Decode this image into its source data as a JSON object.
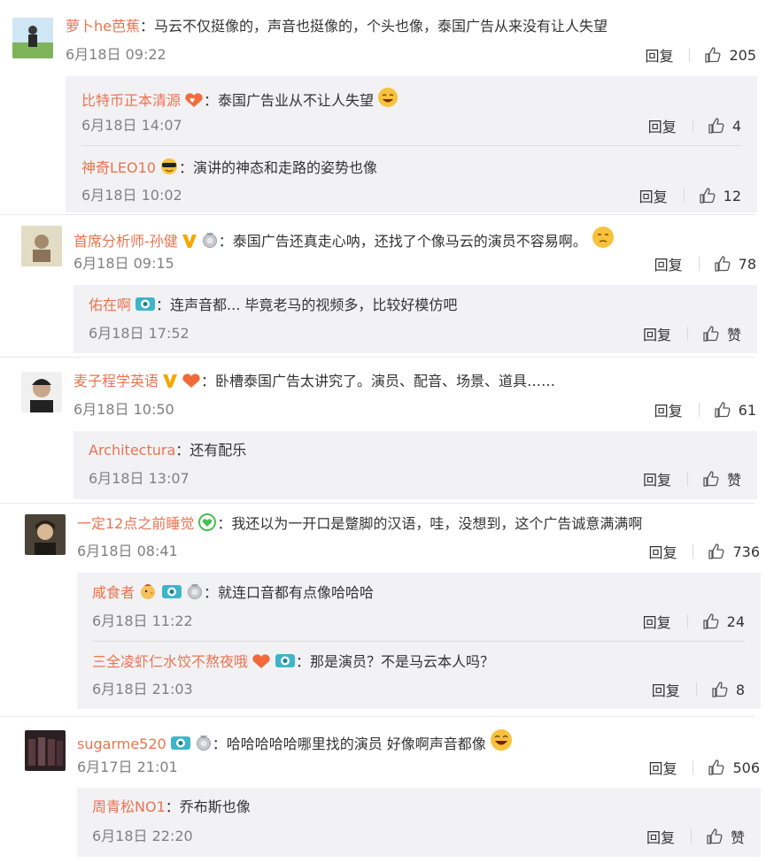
{
  "ui": {
    "reply_label": "回复",
    "colon": "："
  },
  "threads": [
    {
      "user": "萝卜he芭蕉",
      "text": "马云不仅挺像的，声音也挺像的，个头也像，泰国广告从来没有让人失望",
      "time": "6月18日 09:22",
      "likes": "205",
      "replies": [
        {
          "user": "比特币正本清源",
          "text": "泰国广告业从不让人失望",
          "time": "6月18日 14:07",
          "likes": "4"
        },
        {
          "user": "神奇LEO10",
          "text": "演讲的神态和走路的姿势也像",
          "time": "6月18日 10:02",
          "likes": "12"
        }
      ]
    },
    {
      "user": "首席分析师-孙健",
      "text": "泰国广告还真走心呐，还找了个像马云的演员不容易啊。",
      "time": "6月18日 09:15",
      "likes": "78",
      "replies": [
        {
          "user": "佑在啊",
          "text": "连声音都... 毕竟老马的视频多，比较好模仿吧",
          "time": "6月18日 17:52",
          "likes": "赞"
        }
      ]
    },
    {
      "user": "麦子程学英语",
      "text": "卧槽泰国广告太讲究了。演员、配音、场景、道具……",
      "time": "6月18日 10:50",
      "likes": "61",
      "replies": [
        {
          "user": "Architectura",
          "text": "还有配乐",
          "time": "6月18日 13:07",
          "likes": "赞"
        }
      ]
    },
    {
      "user": "一定12点之前睡觉",
      "text": "我还以为一开口是蹩脚的汉语，哇，没想到，这个广告诚意满满啊",
      "time": "6月18日 08:41",
      "likes": "736",
      "replies": [
        {
          "user": "咸食者",
          "text": "就连口音都有点像哈哈哈",
          "time": "6月18日 11:22",
          "likes": "24"
        },
        {
          "user": "三全凌虾仁水饺不熬夜哦",
          "text": "那是演员？不是马云本人吗？",
          "time": "6月18日 21:03",
          "likes": "8"
        }
      ]
    },
    {
      "user": "sugarme520",
      "text": "哈哈哈哈哈哪里找的演员 好像啊声音都像",
      "time": "6月17日 21:01",
      "likes": "506",
      "replies": [
        {
          "user": "周青松NO1",
          "text": "乔布斯也像",
          "time": "6月18日 22:20",
          "likes": "赞"
        }
      ]
    }
  ]
}
